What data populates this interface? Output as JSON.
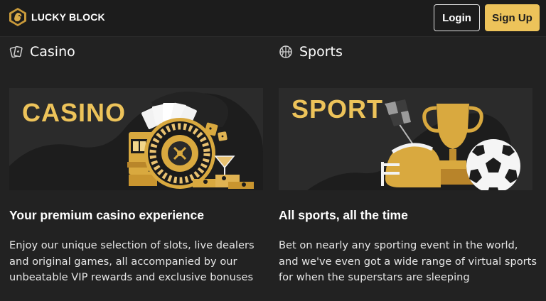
{
  "header": {
    "brand": "LUCKY BLOCK",
    "login_label": "Login",
    "signup_label": "Sign Up"
  },
  "colors": {
    "accent": "#edc35a",
    "background": "#222222",
    "topbar": "#1c1c1c"
  },
  "cards": {
    "casino": {
      "heading": "Casino",
      "icon": "cards-icon",
      "banner_text": "CASINO",
      "title": "Your premium casino experience",
      "description": "Enjoy our unique selection of slots, live dealers and original games, all accompanied by our unbeatable VIP rewards and exclusive bonuses"
    },
    "sports": {
      "heading": "Sports",
      "icon": "basketball-icon",
      "banner_text": "SPORT",
      "title": "All sports, all the time",
      "description": "Bet on nearly any sporting event in the world, and we've even got a wide range of virtual sports for when the superstars are sleeping"
    }
  }
}
